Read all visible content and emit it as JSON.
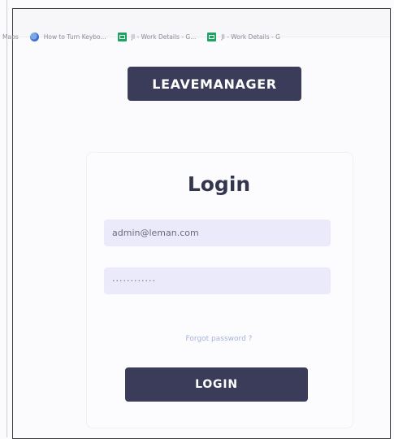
{
  "bookmarks": [
    {
      "label": "Maps",
      "icon": ""
    },
    {
      "label": "How to Turn Keybo...",
      "icon": "globe-icon"
    },
    {
      "label": "JI - Work Details - G...",
      "icon": "sheets-icon"
    },
    {
      "label": "JI - Work Details - G",
      "icon": "sheets-icon"
    }
  ],
  "brand": {
    "label": "LEAVEMANAGER"
  },
  "login": {
    "title": "Login",
    "email_value": "admin@leman.com",
    "password_value": "············",
    "forgot_label": "Forgot password ?",
    "button_label": "LOGIN"
  },
  "colors": {
    "brand_bg": "#3a3c59",
    "field_bg": "#ebeafb",
    "link": "#a6b3dd",
    "title": "#34364e"
  }
}
